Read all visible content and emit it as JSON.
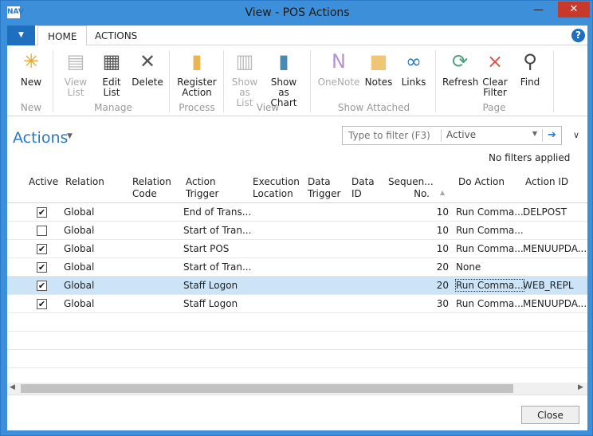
{
  "window": {
    "title": "View - POS Actions",
    "close": "✕",
    "minimize": "—",
    "app_icon": "NAV"
  },
  "tabs": {
    "file": "▼",
    "home": "HOME",
    "actions": "ACTIONS",
    "help": "?"
  },
  "ribbon": {
    "new": "New",
    "view_list": "View List",
    "edit_list": "Edit List",
    "delete": "Delete",
    "register_action": "Register Action",
    "show_as_list": "Show as List",
    "show_as_chart": "Show as Chart",
    "onenote": "OneNote",
    "notes": "Notes",
    "links": "Links",
    "refresh": "Refresh",
    "clear_filter": "Clear Filter",
    "find": "Find",
    "groups": {
      "new": "New",
      "manage": "Manage",
      "process": "Process",
      "view": "View",
      "show_attached": "Show Attached",
      "page": "Page"
    }
  },
  "page": {
    "title": "Actions",
    "filter_placeholder": "Type to filter (F3)",
    "filter_field": "Active",
    "no_filters": "No filters applied"
  },
  "columns": [
    "Active",
    "Relation",
    "Relation Code",
    "Action Trigger",
    "Execution Location",
    "Data Trigger",
    "Data ID",
    "Sequen... No.",
    "Do Action",
    "Action ID"
  ],
  "rows": [
    {
      "active": true,
      "relation": "Global",
      "trigger": "End of Trans...",
      "seq": "10",
      "do_action": "Run Comma...",
      "action_id": "DELPOST"
    },
    {
      "active": false,
      "relation": "Global",
      "trigger": "Start of Tran...",
      "seq": "10",
      "do_action": "Run Comma...",
      "action_id": ""
    },
    {
      "active": true,
      "relation": "Global",
      "trigger": "Start POS",
      "seq": "10",
      "do_action": "Run Comma...",
      "action_id": "MENUUPDA..."
    },
    {
      "active": true,
      "relation": "Global",
      "trigger": "Start of Tran...",
      "seq": "20",
      "do_action": "None",
      "action_id": ""
    },
    {
      "active": true,
      "relation": "Global",
      "trigger": "Staff Logon",
      "seq": "20",
      "do_action": "Run Comma...",
      "action_id": "WEB_REPL"
    },
    {
      "active": true,
      "relation": "Global",
      "trigger": "Staff Logon",
      "seq": "30",
      "do_action": "Run Comma...",
      "action_id": "MENUUPDA..."
    }
  ],
  "footer": {
    "close": "Close"
  }
}
